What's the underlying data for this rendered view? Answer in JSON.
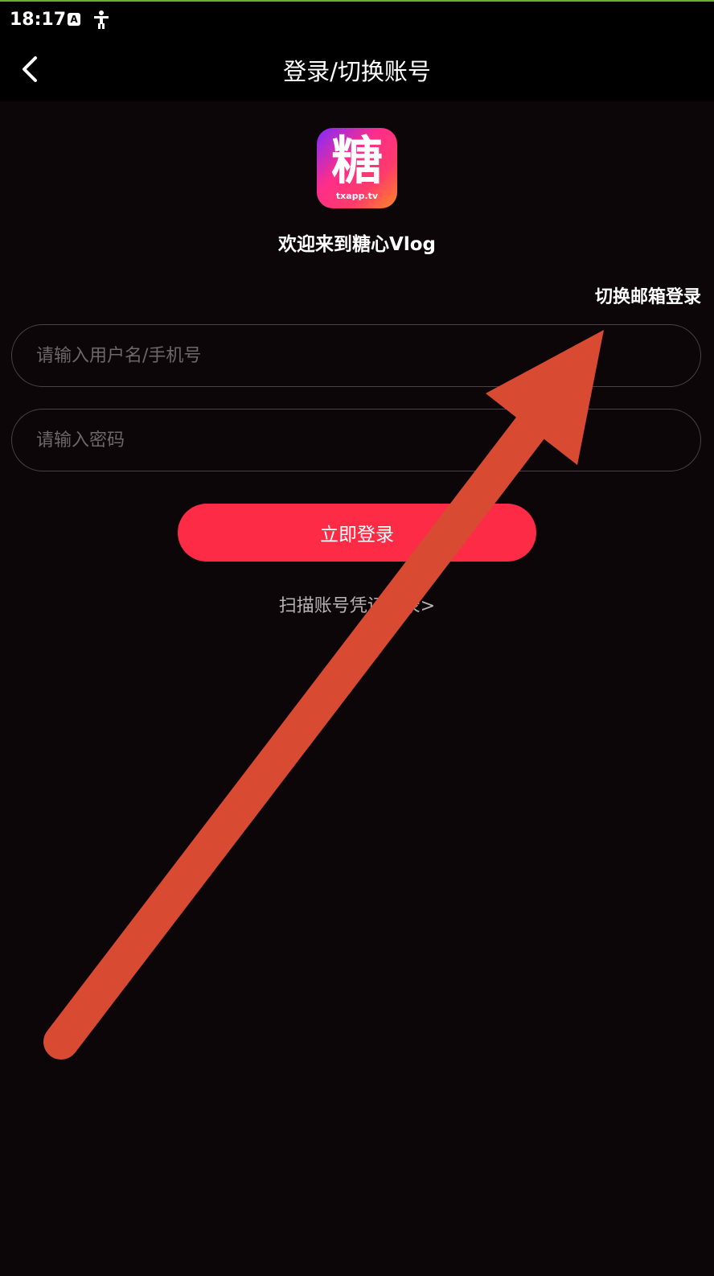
{
  "status_bar": {
    "time": "18:17",
    "icons": [
      "a-notification-icon",
      "accessibility-icon"
    ]
  },
  "nav": {
    "title": "登录/切换账号",
    "back_icon": "chevron-left-icon"
  },
  "logo": {
    "char": "糖",
    "subtext": "txapp.tv"
  },
  "welcome_text": "欢迎来到糖心Vlog",
  "switch_email_label": "切换邮箱登录",
  "form": {
    "username_placeholder": "请输入用户名/手机号",
    "password_placeholder": "请输入密码",
    "login_label": "立即登录",
    "scan_label": "扫描账号凭证登录>"
  },
  "colors": {
    "background": "#0c0609",
    "accent": "#fd2b45",
    "annotation_arrow": "#d84a32"
  }
}
